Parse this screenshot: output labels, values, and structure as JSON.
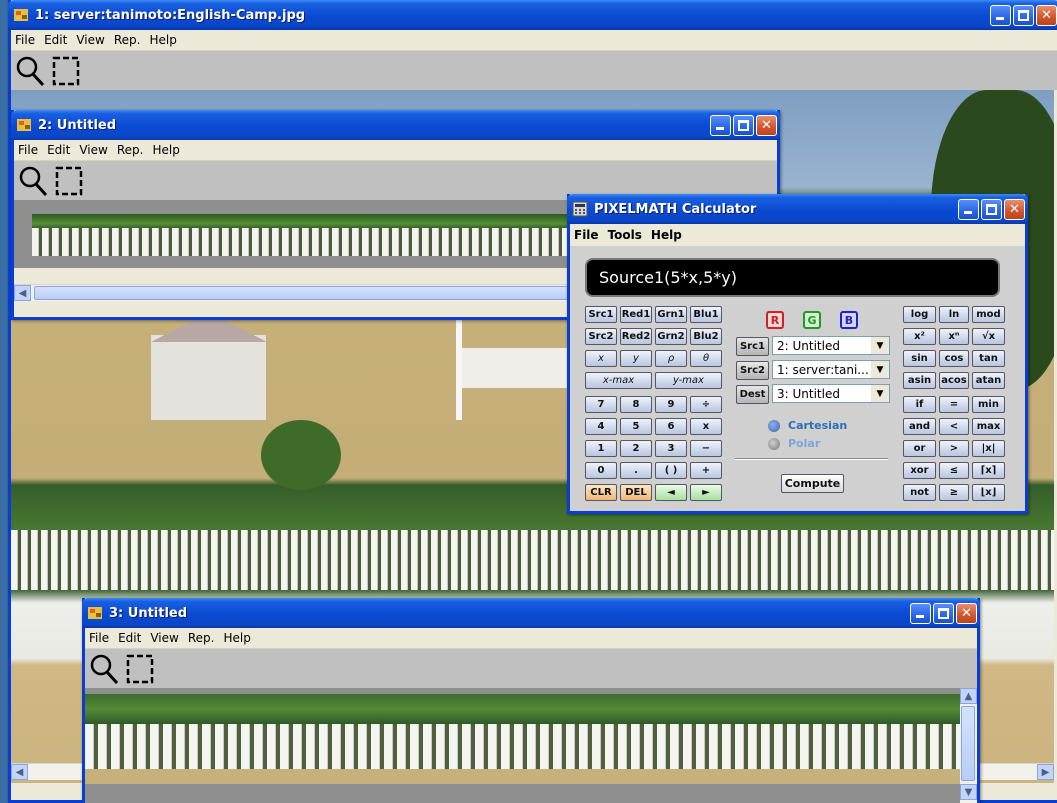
{
  "windows": {
    "main": {
      "title": "1: server:tanimoto:English-Camp.jpg"
    },
    "untitled2": {
      "title": "2: Untitled"
    },
    "untitled3": {
      "title": "3: Untitled"
    },
    "calculator": {
      "title": "PIXELMATH Calculator"
    }
  },
  "image_menu": [
    "File",
    "Edit",
    "View",
    "Rep.",
    "Help"
  ],
  "calc_menu": [
    "File",
    "Tools",
    "Help"
  ],
  "icons": {
    "zoom": "magnifier-icon",
    "select": "selection-rectangle-icon",
    "app": "pixelmath-image-icon"
  },
  "colors": {
    "titlebar": "#0a46c8",
    "close": "#d4542a",
    "desktop": "#3a6ea5",
    "display_bg": "#000000",
    "red": "#cc2222",
    "green": "#229922",
    "blue": "#2222cc"
  },
  "calculator": {
    "expression": "Source1(5*x,5*y)",
    "keys": {
      "src_row": [
        "Src1",
        "Red1",
        "Grn1",
        "Blu1"
      ],
      "src2_row": [
        "Src2",
        "Red2",
        "Grn2",
        "Blu2"
      ],
      "var_row": [
        "x",
        "y",
        "ρ",
        "θ"
      ],
      "max_row": [
        "x-max",
        "y-max"
      ],
      "num_rows": [
        [
          "7",
          "8",
          "9",
          "÷"
        ],
        [
          "4",
          "5",
          "6",
          "x"
        ],
        [
          "1",
          "2",
          "3",
          "−"
        ],
        [
          "0",
          ".",
          "( )",
          "+"
        ]
      ],
      "edit_row": [
        "CLR",
        "DEL",
        "◄",
        "►"
      ],
      "func_rows": [
        [
          "log",
          "ln",
          "mod"
        ],
        [
          "x²",
          "xⁿ",
          "√x"
        ],
        [
          "sin",
          "cos",
          "tan"
        ],
        [
          "asin",
          "acos",
          "atan"
        ],
        [
          "if",
          "=",
          "min"
        ],
        [
          "and",
          "<",
          "max"
        ],
        [
          "or",
          ">",
          "|x|"
        ],
        [
          "xor",
          "≤",
          "⌈x⌉"
        ],
        [
          "not",
          "≥",
          "⌊x⌋"
        ]
      ]
    },
    "channels": [
      "R",
      "G",
      "B"
    ],
    "source1": {
      "label": "Src1",
      "value": "2: Untitled"
    },
    "source2": {
      "label": "Src2",
      "value": "1: server:tani..."
    },
    "dest": {
      "label": "Dest",
      "value": "3: Untitled"
    },
    "coords": [
      "Cartesian",
      "Polar"
    ],
    "coord_selected": "Cartesian",
    "compute": "Compute"
  }
}
